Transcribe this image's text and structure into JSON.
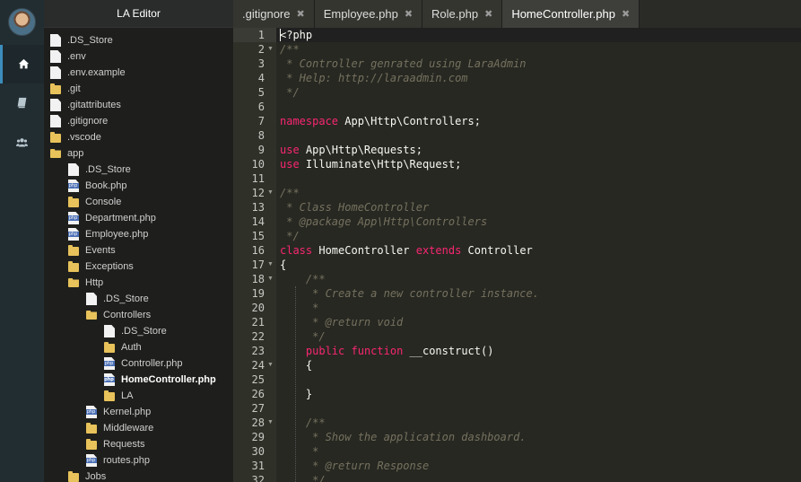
{
  "app": {
    "title": "LA Editor"
  },
  "rail": {
    "items": [
      {
        "icon": "home-icon",
        "active": true
      },
      {
        "icon": "book-icon",
        "active": false
      },
      {
        "icon": "users-icon",
        "active": false
      }
    ]
  },
  "tree": [
    {
      "name": ".DS_Store",
      "type": "file",
      "depth": 0
    },
    {
      "name": ".env",
      "type": "file",
      "depth": 0
    },
    {
      "name": ".env.example",
      "type": "file",
      "depth": 0
    },
    {
      "name": ".git",
      "type": "folder",
      "depth": 0
    },
    {
      "name": ".gitattributes",
      "type": "file",
      "depth": 0
    },
    {
      "name": ".gitignore",
      "type": "file",
      "depth": 0
    },
    {
      "name": ".vscode",
      "type": "folder",
      "depth": 0
    },
    {
      "name": "app",
      "type": "folder-open",
      "depth": 0
    },
    {
      "name": ".DS_Store",
      "type": "file",
      "depth": 1
    },
    {
      "name": "Book.php",
      "type": "php",
      "depth": 1
    },
    {
      "name": "Console",
      "type": "folder",
      "depth": 1
    },
    {
      "name": "Department.php",
      "type": "php",
      "depth": 1
    },
    {
      "name": "Employee.php",
      "type": "php",
      "depth": 1
    },
    {
      "name": "Events",
      "type": "folder",
      "depth": 1
    },
    {
      "name": "Exceptions",
      "type": "folder",
      "depth": 1
    },
    {
      "name": "Http",
      "type": "folder-open",
      "depth": 1
    },
    {
      "name": ".DS_Store",
      "type": "file",
      "depth": 2
    },
    {
      "name": "Controllers",
      "type": "folder-open",
      "depth": 2
    },
    {
      "name": ".DS_Store",
      "type": "file",
      "depth": 3
    },
    {
      "name": "Auth",
      "type": "folder",
      "depth": 3
    },
    {
      "name": "Controller.php",
      "type": "php",
      "depth": 3
    },
    {
      "name": "HomeController.php",
      "type": "php",
      "depth": 3,
      "selected": true
    },
    {
      "name": "LA",
      "type": "folder",
      "depth": 3
    },
    {
      "name": "Kernel.php",
      "type": "php",
      "depth": 2
    },
    {
      "name": "Middleware",
      "type": "folder",
      "depth": 2
    },
    {
      "name": "Requests",
      "type": "folder",
      "depth": 2
    },
    {
      "name": "routes.php",
      "type": "php",
      "depth": 2
    },
    {
      "name": "Jobs",
      "type": "folder",
      "depth": 1
    }
  ],
  "tabs": [
    {
      "label": ".gitignore",
      "active": false
    },
    {
      "label": "Employee.php",
      "active": false
    },
    {
      "label": "Role.php",
      "active": false
    },
    {
      "label": "HomeController.php",
      "active": true
    }
  ],
  "tab_close_glyph": "✖",
  "colors": {
    "comment": "#75715e",
    "keyword": "#f92672",
    "plain": "#f8f8f2",
    "tag": "#f8f8f2",
    "accent": "#3c8dbc"
  },
  "editor": {
    "lines": [
      {
        "n": "1",
        "fold": false,
        "tokens": [
          [
            "plain",
            "<?php"
          ]
        ]
      },
      {
        "n": "2",
        "fold": true,
        "tokens": [
          [
            "comment",
            "/**"
          ]
        ]
      },
      {
        "n": "3",
        "fold": false,
        "tokens": [
          [
            "comment",
            " * Controller genrated using LaraAdmin"
          ]
        ]
      },
      {
        "n": "4",
        "fold": false,
        "tokens": [
          [
            "comment",
            " * Help: http://laraadmin.com"
          ]
        ]
      },
      {
        "n": "5",
        "fold": false,
        "tokens": [
          [
            "comment",
            " */"
          ]
        ]
      },
      {
        "n": "6",
        "fold": false,
        "tokens": []
      },
      {
        "n": "7",
        "fold": false,
        "tokens": [
          [
            "keyword",
            "namespace"
          ],
          [
            "plain",
            " App\\Http\\Controllers;"
          ]
        ]
      },
      {
        "n": "8",
        "fold": false,
        "tokens": []
      },
      {
        "n": "9",
        "fold": false,
        "tokens": [
          [
            "keyword",
            "use"
          ],
          [
            "plain",
            " App\\Http\\Requests;"
          ]
        ]
      },
      {
        "n": "10",
        "fold": false,
        "tokens": [
          [
            "keyword",
            "use"
          ],
          [
            "plain",
            " Illuminate\\Http\\Request;"
          ]
        ]
      },
      {
        "n": "11",
        "fold": false,
        "tokens": []
      },
      {
        "n": "12",
        "fold": true,
        "tokens": [
          [
            "comment",
            "/**"
          ]
        ]
      },
      {
        "n": "13",
        "fold": false,
        "tokens": [
          [
            "comment",
            " * Class HomeController"
          ]
        ]
      },
      {
        "n": "14",
        "fold": false,
        "tokens": [
          [
            "comment",
            " * @package App\\Http\\Controllers"
          ]
        ]
      },
      {
        "n": "15",
        "fold": false,
        "tokens": [
          [
            "comment",
            " */"
          ]
        ]
      },
      {
        "n": "16",
        "fold": false,
        "tokens": [
          [
            "keyword",
            "class"
          ],
          [
            "plain",
            " HomeController "
          ],
          [
            "keyword",
            "extends"
          ],
          [
            "plain",
            " Controller"
          ]
        ]
      },
      {
        "n": "17",
        "fold": true,
        "tokens": [
          [
            "plain",
            "{"
          ]
        ]
      },
      {
        "n": "18",
        "fold": true,
        "tokens": [
          [
            "plain",
            "    "
          ],
          [
            "comment",
            "/**"
          ]
        ]
      },
      {
        "n": "19",
        "fold": false,
        "tokens": [
          [
            "comment",
            "     * Create a new controller instance."
          ]
        ]
      },
      {
        "n": "20",
        "fold": false,
        "tokens": [
          [
            "comment",
            "     *"
          ]
        ]
      },
      {
        "n": "21",
        "fold": false,
        "tokens": [
          [
            "comment",
            "     * @return void"
          ]
        ]
      },
      {
        "n": "22",
        "fold": false,
        "tokens": [
          [
            "comment",
            "     */"
          ]
        ]
      },
      {
        "n": "23",
        "fold": false,
        "tokens": [
          [
            "plain",
            "    "
          ],
          [
            "keyword",
            "public"
          ],
          [
            "plain",
            " "
          ],
          [
            "keyword",
            "function"
          ],
          [
            "plain",
            " __construct()"
          ]
        ]
      },
      {
        "n": "24",
        "fold": true,
        "tokens": [
          [
            "plain",
            "    {"
          ]
        ]
      },
      {
        "n": "25",
        "fold": false,
        "tokens": []
      },
      {
        "n": "26",
        "fold": false,
        "tokens": [
          [
            "plain",
            "    }"
          ]
        ]
      },
      {
        "n": "27",
        "fold": false,
        "tokens": []
      },
      {
        "n": "28",
        "fold": true,
        "tokens": [
          [
            "plain",
            "    "
          ],
          [
            "comment",
            "/**"
          ]
        ]
      },
      {
        "n": "29",
        "fold": false,
        "tokens": [
          [
            "comment",
            "     * Show the application dashboard."
          ]
        ]
      },
      {
        "n": "30",
        "fold": false,
        "tokens": [
          [
            "comment",
            "     *"
          ]
        ]
      },
      {
        "n": "31",
        "fold": false,
        "tokens": [
          [
            "comment",
            "     * @return Response"
          ]
        ]
      },
      {
        "n": "32",
        "fold": false,
        "tokens": [
          [
            "comment",
            "     */"
          ]
        ]
      }
    ]
  }
}
